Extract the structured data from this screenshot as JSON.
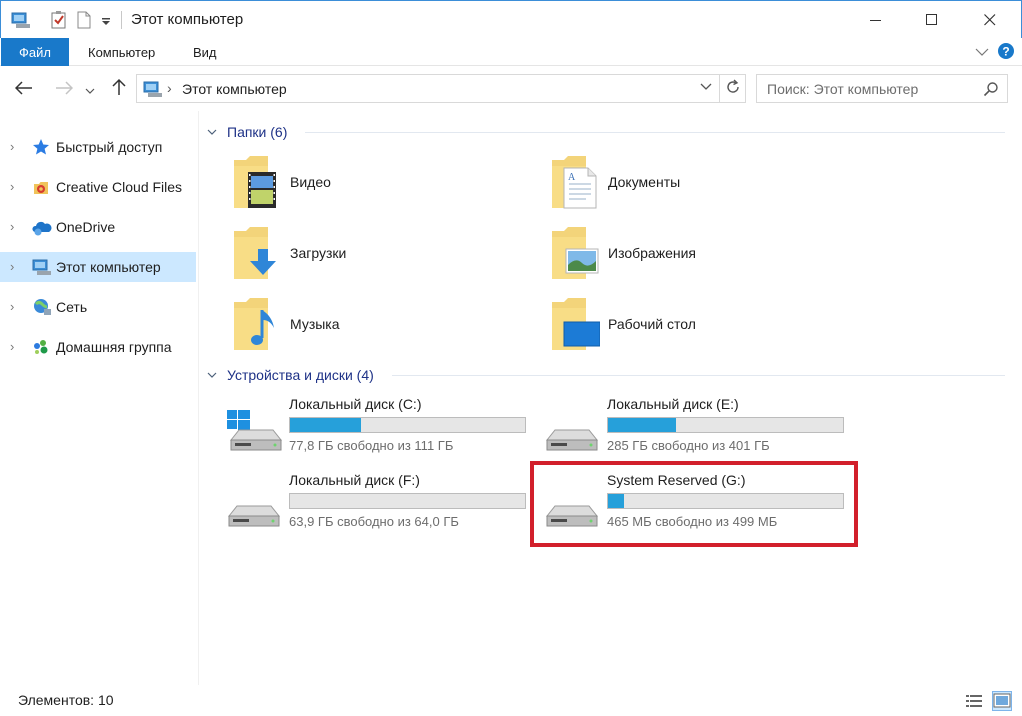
{
  "window": {
    "title": "Этот компьютер",
    "minimize": "–",
    "maximize": "☐",
    "close": "✕"
  },
  "ribbon": {
    "tabs": [
      "Файл",
      "Компьютер",
      "Вид"
    ],
    "expand_icon": "chevron-down-icon",
    "help_icon": "help-icon"
  },
  "nav": {
    "address": "Этот компьютер",
    "search_placeholder": "Поиск: Этот компьютер"
  },
  "sidebar": {
    "items": [
      {
        "label": "Быстрый доступ",
        "icon": "star-icon"
      },
      {
        "label": "Creative Cloud Files",
        "icon": "creative-cloud-icon"
      },
      {
        "label": "OneDrive",
        "icon": "onedrive-icon"
      },
      {
        "label": "Этот компьютер",
        "icon": "computer-icon",
        "selected": true
      },
      {
        "label": "Сеть",
        "icon": "network-icon"
      },
      {
        "label": "Домашняя группа",
        "icon": "homegroup-icon"
      }
    ]
  },
  "folders": {
    "header": "Папки (6)",
    "items": [
      {
        "label": "Видео",
        "icon": "video-folder-icon"
      },
      {
        "label": "Документы",
        "icon": "documents-folder-icon"
      },
      {
        "label": "Загрузки",
        "icon": "downloads-folder-icon"
      },
      {
        "label": "Изображения",
        "icon": "pictures-folder-icon"
      },
      {
        "label": "Музыка",
        "icon": "music-folder-icon"
      },
      {
        "label": "Рабочий стол",
        "icon": "desktop-folder-icon"
      }
    ]
  },
  "drives": {
    "header": "Устройства и диски (4)",
    "items": [
      {
        "name": "Локальный диск (C:)",
        "free_text": "77,8 ГБ свободно из 111 ГБ",
        "used_fraction": 0.3,
        "icon": "windows-drive-icon"
      },
      {
        "name": "Локальный диск (E:)",
        "free_text": "285 ГБ свободно из 401 ГБ",
        "used_fraction": 0.29,
        "icon": "drive-icon"
      },
      {
        "name": "Локальный диск (F:)",
        "free_text": "63,9 ГБ свободно из 64,0 ГБ",
        "used_fraction": 0.0,
        "icon": "drive-icon"
      },
      {
        "name": "System Reserved (G:)",
        "free_text": "465 МБ свободно из 499 МБ",
        "used_fraction": 0.07,
        "icon": "drive-icon"
      }
    ]
  },
  "status": {
    "items_count": "Элементов: 10"
  },
  "colors": {
    "accent": "#1979ca",
    "drive_bar": "#26a0da",
    "highlight": "#d21f2b",
    "selected": "#cce8ff"
  }
}
